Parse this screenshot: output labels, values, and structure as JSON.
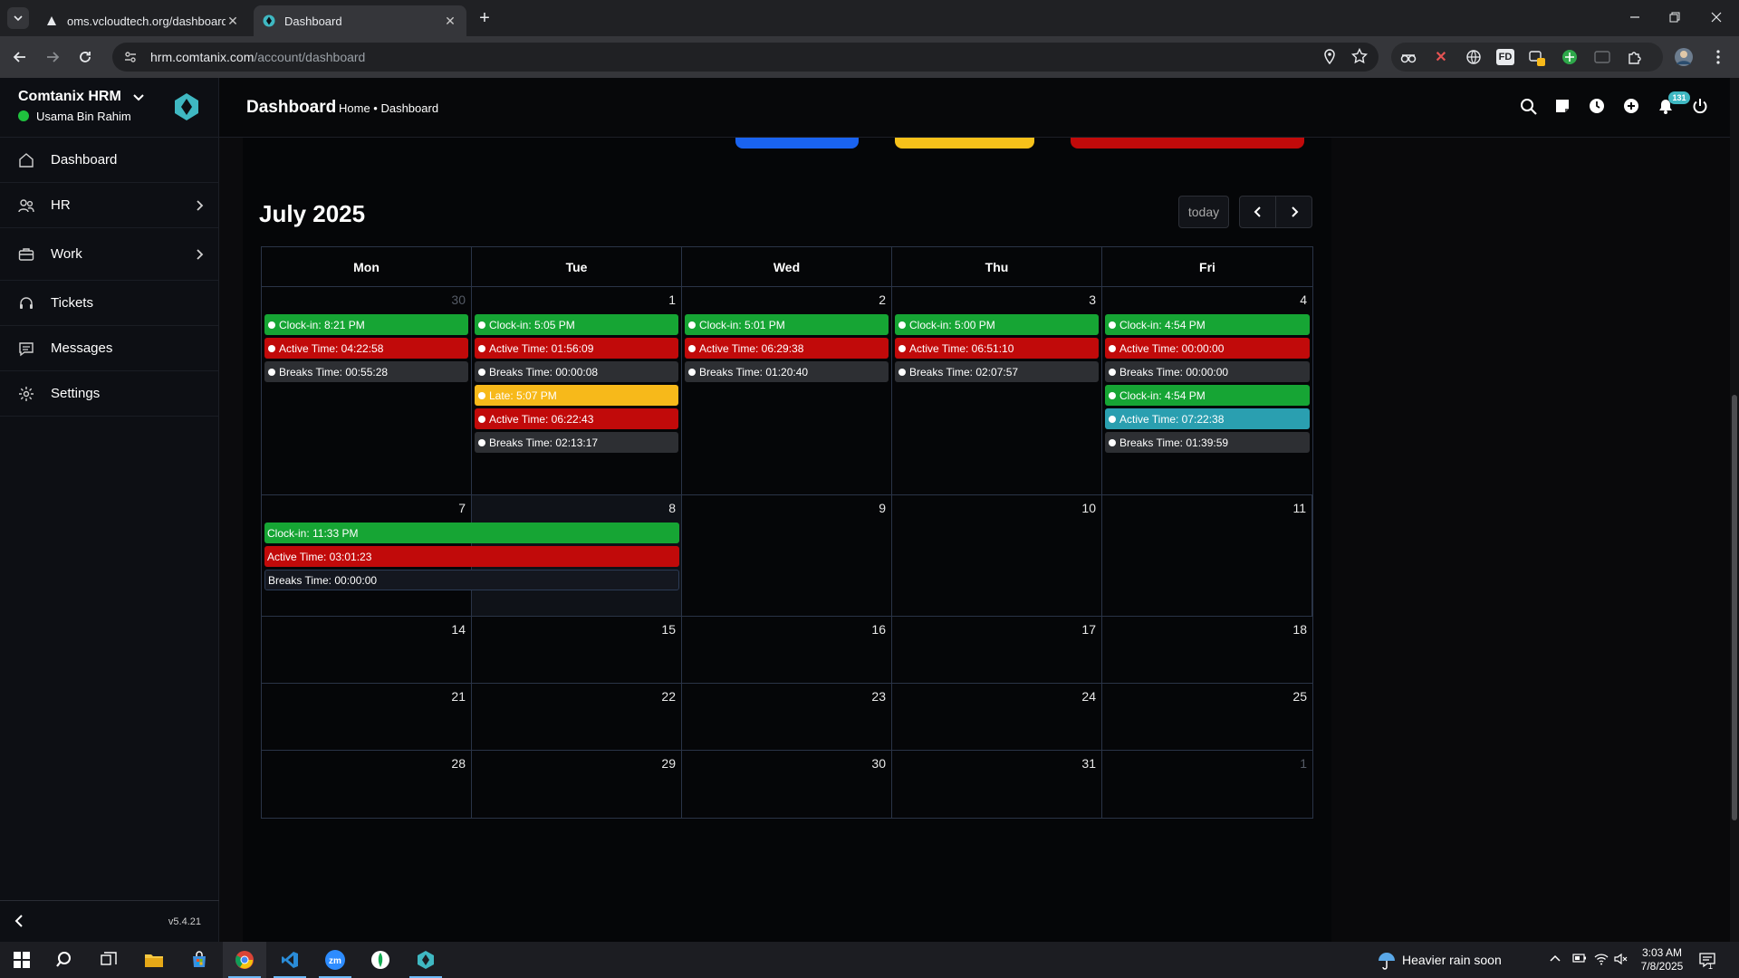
{
  "browser": {
    "tabs": [
      {
        "title": "oms.vcloudtech.org/dashboard",
        "active": false
      },
      {
        "title": "Dashboard",
        "active": true
      }
    ],
    "url_host": "hrm.comtanix.com",
    "url_path": "/account/dashboard",
    "extensions": [
      "FD"
    ],
    "extension_badge": "1"
  },
  "sidebar": {
    "brand": "Comtanix HRM",
    "user": "Usama Bin Rahim",
    "items": [
      {
        "label": "Dashboard",
        "icon": "home-icon",
        "has_children": false
      },
      {
        "label": "HR",
        "icon": "users-icon",
        "has_children": true
      },
      {
        "label": "Work",
        "icon": "briefcase-icon",
        "has_children": true
      },
      {
        "label": "Tickets",
        "icon": "headset-icon",
        "has_children": false
      },
      {
        "label": "Messages",
        "icon": "message-icon",
        "has_children": false
      },
      {
        "label": "Settings",
        "icon": "gear-icon",
        "has_children": false
      }
    ],
    "version": "v5.4.21"
  },
  "header": {
    "title": "Dashboard",
    "breadcrumb": "Home • Dashboard",
    "notification_count": "131"
  },
  "calendar": {
    "title": "July 2025",
    "today_label": "today",
    "weekdays": [
      "Mon",
      "Tue",
      "Wed",
      "Thu",
      "Fri"
    ],
    "weeks": [
      {
        "days": [
          {
            "num": "30",
            "other_month": true,
            "events": [
              {
                "text": "Clock-in: 8:21 PM",
                "color": "green"
              },
              {
                "text": "Active Time: 04:22:58",
                "color": "red"
              },
              {
                "text": "Breaks Time: 00:55:28",
                "color": "grey"
              }
            ]
          },
          {
            "num": "1",
            "events": [
              {
                "text": "Clock-in: 5:05 PM",
                "color": "green"
              },
              {
                "text": "Active Time: 01:56:09",
                "color": "red"
              },
              {
                "text": "Breaks Time: 00:00:08",
                "color": "grey"
              },
              {
                "text": "Late: 5:07 PM",
                "color": "yellow"
              },
              {
                "text": "Active Time: 06:22:43",
                "color": "red"
              },
              {
                "text": "Breaks Time: 02:13:17",
                "color": "grey"
              }
            ]
          },
          {
            "num": "2",
            "events": [
              {
                "text": "Clock-in: 5:01 PM",
                "color": "green"
              },
              {
                "text": "Active Time: 06:29:38",
                "color": "red"
              },
              {
                "text": "Breaks Time: 01:20:40",
                "color": "grey"
              }
            ]
          },
          {
            "num": "3",
            "events": [
              {
                "text": "Clock-in: 5:00 PM",
                "color": "green"
              },
              {
                "text": "Active Time: 06:51:10",
                "color": "red"
              },
              {
                "text": "Breaks Time: 02:07:57",
                "color": "grey"
              }
            ]
          },
          {
            "num": "4",
            "events": [
              {
                "text": "Clock-in: 4:54 PM",
                "color": "green"
              },
              {
                "text": "Active Time: 00:00:00",
                "color": "red"
              },
              {
                "text": "Breaks Time: 00:00:00",
                "color": "grey"
              },
              {
                "text": "Clock-in: 4:54 PM",
                "color": "green"
              },
              {
                "text": "Active Time: 07:22:38",
                "color": "teal"
              },
              {
                "text": "Breaks Time: 01:39:59",
                "color": "grey"
              }
            ]
          }
        ]
      },
      {
        "spanning_events": [
          {
            "text": "Clock-in: 11:33 PM",
            "color": "green"
          },
          {
            "text": "Active Time: 03:01:23",
            "color": "red"
          },
          {
            "text": "Breaks Time: 00:00:00",
            "color": "grey"
          }
        ],
        "days": [
          {
            "num": "7",
            "events": []
          },
          {
            "num": "8",
            "today": true,
            "events": []
          },
          {
            "num": "9",
            "events": []
          },
          {
            "num": "10",
            "events": []
          },
          {
            "num": "11",
            "events": []
          }
        ]
      },
      {
        "days": [
          {
            "num": "14",
            "events": []
          },
          {
            "num": "15",
            "events": []
          },
          {
            "num": "16",
            "events": []
          },
          {
            "num": "17",
            "events": []
          },
          {
            "num": "18",
            "events": []
          }
        ]
      },
      {
        "days": [
          {
            "num": "21",
            "events": []
          },
          {
            "num": "22",
            "events": []
          },
          {
            "num": "23",
            "events": []
          },
          {
            "num": "24",
            "events": []
          },
          {
            "num": "25",
            "events": []
          }
        ]
      },
      {
        "days": [
          {
            "num": "28",
            "events": []
          },
          {
            "num": "29",
            "events": []
          },
          {
            "num": "30",
            "events": []
          },
          {
            "num": "31",
            "events": []
          },
          {
            "num": "1",
            "other_month": true,
            "events": []
          }
        ]
      }
    ]
  },
  "colors": {
    "green": "#16a534",
    "red": "#c10a0a",
    "grey": "#2d2f33",
    "yellow": "#f7b91a",
    "teal": "#2a9fb0",
    "status_online": "#1fc13e",
    "accent": "#3fb8c2"
  },
  "taskbar": {
    "weather": "Heavier rain soon",
    "time": "3:03 AM",
    "date": "7/8/2025",
    "notification_count": "1"
  }
}
